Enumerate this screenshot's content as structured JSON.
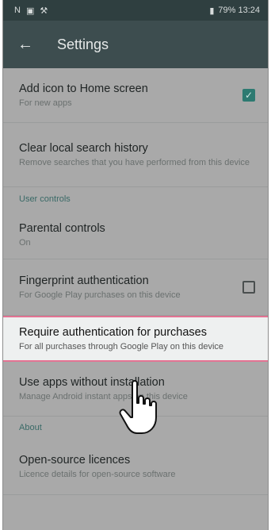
{
  "statusbar": {
    "left_icons": [
      "notification-icon",
      "image-icon",
      "wrench-icon"
    ],
    "right_text": "79% 13:24"
  },
  "toolbar": {
    "title": "Settings",
    "back_icon": "arrow-left-icon"
  },
  "items": [
    {
      "primary": "Add icon to Home screen",
      "secondary": "For new apps",
      "checkbox": "checked"
    },
    {
      "primary": "Clear local search history",
      "secondary": "Remove searches that you have performed from this device",
      "checkbox": "none"
    }
  ],
  "section_user_controls": "User controls",
  "items2": [
    {
      "primary": "Parental controls",
      "secondary": "On",
      "checkbox": "none"
    },
    {
      "primary": "Fingerprint authentication",
      "secondary": "For Google Play purchases on this device",
      "checkbox": "unchecked"
    },
    {
      "primary": "Require authentication for purchases",
      "secondary": "For all purchases through Google Play on this device",
      "checkbox": "none",
      "highlighted": true
    },
    {
      "primary": "Use apps without installation",
      "secondary": "Manage Android instant apps on this device",
      "checkbox": "none"
    }
  ],
  "section_about": "About",
  "items3": [
    {
      "primary": "Open-source licences",
      "secondary": "Licence details for open-source software",
      "checkbox": "none"
    }
  ],
  "colors": {
    "statusbar": "#2f3f40",
    "toolbar": "#3d4d4f",
    "section": "#3a6a67",
    "checkbox_checked": "#2d7a71",
    "highlight_border": "#e37393"
  }
}
